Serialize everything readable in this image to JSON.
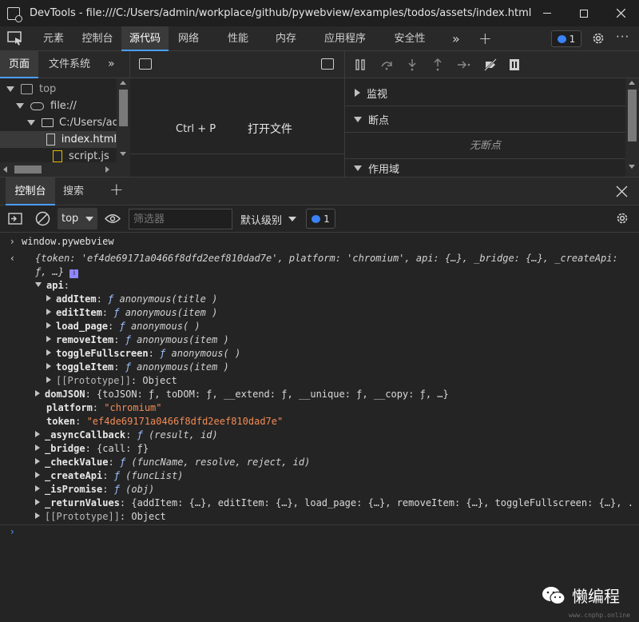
{
  "window": {
    "title": "DevTools - file:///C:/Users/admin/workplace/github/pywebview/examples/todos/assets/index.html"
  },
  "main_tabs": [
    {
      "label": "元素"
    },
    {
      "label": "控制台"
    },
    {
      "label": "源代码"
    },
    {
      "label": "网络"
    },
    {
      "label": "性能"
    },
    {
      "label": "内存"
    },
    {
      "label": "应用程序"
    },
    {
      "label": "安全性"
    }
  ],
  "issues_count": "1",
  "navigator": {
    "tabs": [
      {
        "label": "页面"
      },
      {
        "label": "文件系统"
      }
    ],
    "tree": [
      {
        "label": "top"
      },
      {
        "label": "file://"
      },
      {
        "label": "C:/Users/adm"
      },
      {
        "label": "index.html"
      },
      {
        "label": "script.js"
      }
    ]
  },
  "editor": {
    "shortcut": "Ctrl + P",
    "open_file": "打开文件"
  },
  "debugger": {
    "sections": [
      {
        "label": "监视"
      },
      {
        "label": "断点"
      },
      {
        "label": "作用域"
      }
    ],
    "no_breakpoints": "无断点"
  },
  "drawer": {
    "tabs": [
      {
        "label": "控制台"
      },
      {
        "label": "搜索"
      }
    ]
  },
  "console_toolbar": {
    "context": "top",
    "filter_placeholder": "筛选器",
    "level": "默认级别",
    "issues_count": "1"
  },
  "console": {
    "command": "window.pywebview",
    "summary": {
      "token_key": "token",
      "token_val": "'ef4de69171a0466f8dfd2eef810dad7e'",
      "platform_key": "platform",
      "platform_val": "'chromium'",
      "rest": ", api: {…}, _bridge: {…}, _createApi:",
      "cont": "ƒ, …}",
      "info": "i"
    },
    "api_label": "api",
    "api_items": [
      {
        "key": "addItem",
        "sig": "anonymous(title )"
      },
      {
        "key": "editItem",
        "sig": "anonymous(item )"
      },
      {
        "key": "load_page",
        "sig": "anonymous( )"
      },
      {
        "key": "removeItem",
        "sig": "anonymous(item )"
      },
      {
        "key": "toggleFullscreen",
        "sig": "anonymous( )"
      },
      {
        "key": "toggleItem",
        "sig": "anonymous(item )"
      }
    ],
    "api_proto_key": "[[Prototype]]",
    "api_proto_val": "Object",
    "domjson_key": "domJSON",
    "domjson_val": "{toJSON: ƒ, toDOM: ƒ, __extend: ƒ, __unique: ƒ, __copy: ƒ, …}",
    "platform_key": "platform",
    "platform_val": "\"chromium\"",
    "token_key": "token",
    "token_val": "\"ef4de69171a0466f8dfd2eef810dad7e\"",
    "async_key": "_asyncCallback",
    "async_val": "(result, id)",
    "bridge_key": "_bridge",
    "bridge_val": "{call: ƒ}",
    "check_key": "_checkValue",
    "check_val": "(funcName, resolve, reject, id)",
    "create_key": "_createApi",
    "create_val": "(funcList)",
    "promise_key": "_isPromise",
    "promise_val": "(obj)",
    "return_key": "_returnValues",
    "return_val": "{addItem: {…}, editItem: {…}, load_page: {…}, removeItem: {…}, toggleFullscreen: {…}, .",
    "proto_key": "[[Prototype]]",
    "proto_val": "Object"
  },
  "watermark": {
    "text": "懒编程",
    "url": "www.cnphp.online"
  }
}
